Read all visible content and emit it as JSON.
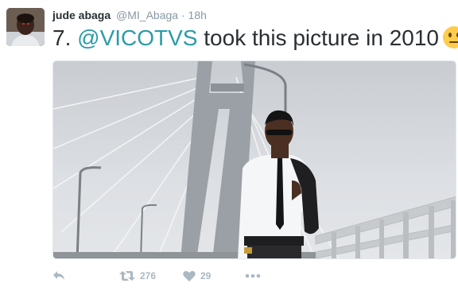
{
  "tweet": {
    "author_name": "jude abaga",
    "handle": "@MI_Abaga",
    "separator": "·",
    "time": "18h",
    "text_prefix": "7. ",
    "mention": "@VICOTVS",
    "text_suffix": " took this picture in 2010",
    "emoji": "neutral-face-emoji"
  },
  "actions": {
    "reply_icon": "reply-icon",
    "retweet_icon": "retweet-icon",
    "retweet_count": "276",
    "like_icon": "heart-icon",
    "like_count": "29",
    "more_icon": "more-icon"
  },
  "colors": {
    "mention": "#2b9ba8",
    "muted": "#8899a6",
    "action": "#aab8c2"
  }
}
